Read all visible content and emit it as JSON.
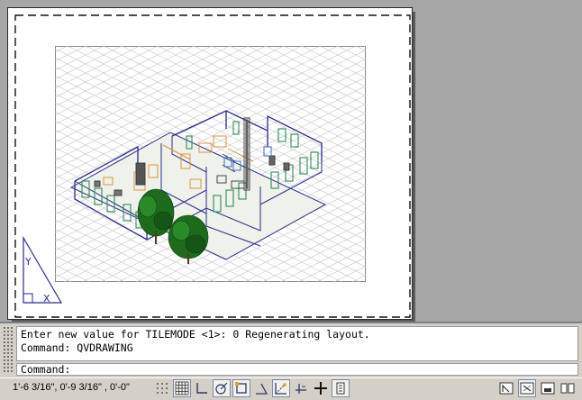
{
  "window": {
    "space": "paper-space layout",
    "colors": {
      "background": "#a6a6a6",
      "paper": "#ffffff",
      "walls": "#2a2a8a",
      "windows": "#2e8b57",
      "furniture": "#e0923a",
      "trees": "#1e6b1e"
    }
  },
  "ucs": {
    "y_label": "Y",
    "x_label": "X"
  },
  "command_line": {
    "history": [
      "Enter new value for TILEMODE <1>: 0 Regenerating layout.",
      "Command: QVDRAWING"
    ],
    "prompt": "Command:"
  },
  "status_bar": {
    "coordinates": "1'-6 3/16\", 0'-9 3/16\" , 0'-0\"",
    "toggles": [
      {
        "name": "infer-constraints",
        "icon": "dotted-grid-icon",
        "on": false
      },
      {
        "name": "snap-mode",
        "icon": "snap-icon",
        "on": false
      },
      {
        "name": "grid-display",
        "icon": "grid-icon",
        "on": true
      },
      {
        "name": "ortho-mode",
        "icon": "ortho-icon",
        "on": false
      },
      {
        "name": "polar-tracking",
        "icon": "polar-icon",
        "on": true
      },
      {
        "name": "object-snap",
        "icon": "osnap-icon",
        "on": true
      },
      {
        "name": "3d-object-snap",
        "icon": "3dosnap-icon",
        "on": false
      },
      {
        "name": "object-snap-tracking",
        "icon": "otrack-icon",
        "on": false
      },
      {
        "name": "dynamic-ucs",
        "icon": "ducs-icon",
        "on": true
      },
      {
        "name": "dynamic-input",
        "icon": "dyn-icon",
        "on": false
      },
      {
        "name": "show-lineweight",
        "icon": "lineweight-icon",
        "on": false
      },
      {
        "name": "quick-properties",
        "icon": "qp-icon",
        "on": true
      }
    ],
    "right_buttons": [
      {
        "name": "model-or-paper",
        "icon": "model-icon"
      },
      {
        "name": "quick-view-layouts",
        "icon": "layouts-icon",
        "on": true
      },
      {
        "name": "quick-view-drawings",
        "icon": "drawings-icon"
      },
      {
        "name": "layout-view",
        "icon": "layout-icon"
      }
    ]
  }
}
